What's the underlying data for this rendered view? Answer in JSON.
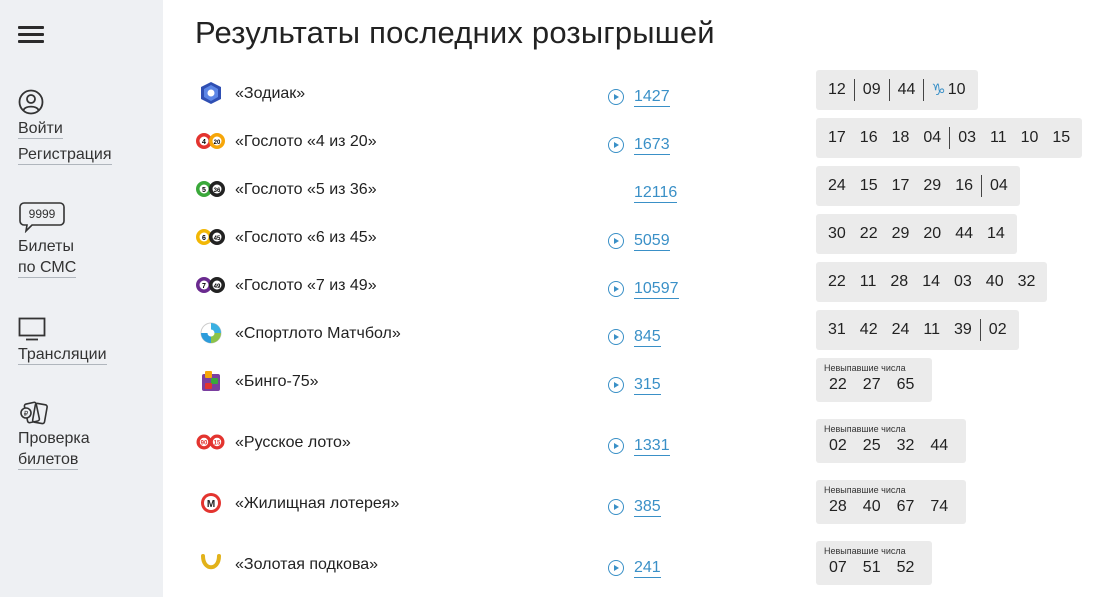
{
  "sidebar": {
    "login": "Войти",
    "register": "Регистрация",
    "sms_badge": "9999",
    "sms_line1": "Билеты",
    "sms_line2": "по СМС",
    "broadcasts": "Трансляции",
    "check_line1": "Проверка",
    "check_line2": "билетов"
  },
  "page": {
    "title": "Результаты последних розыгрышей"
  },
  "colors": {
    "link": "#3a90c7",
    "sidebar_bg": "#eef0f3",
    "result_bg": "#ebebeb"
  },
  "lotteries": [
    {
      "name": "«Зодиак»",
      "draw": "1427",
      "icon": "zodiac-icon",
      "numbers": [
        "12",
        "09",
        "44"
      ],
      "sign": "♑",
      "sign_num": "10"
    },
    {
      "name": "«Гослото «4 из 20»",
      "draw": "1673",
      "icon": "gosloto-4-20-icon",
      "numbers": [
        "17",
        "16",
        "18",
        "04"
      ],
      "numbers2": [
        "03",
        "11",
        "10",
        "15"
      ]
    },
    {
      "name": "«Гослото «5 из 36»",
      "draw": "12116",
      "icon": "gosloto-5-36-icon",
      "numbers": [
        "24",
        "15",
        "17",
        "29",
        "16"
      ],
      "numbers2": [
        "04"
      ]
    },
    {
      "name": "«Гослото «6 из 45»",
      "draw": "5059",
      "icon": "gosloto-6-45-icon",
      "numbers": [
        "30",
        "22",
        "29",
        "20",
        "44",
        "14"
      ]
    },
    {
      "name": "«Гослото «7 из 49»",
      "draw": "10597",
      "icon": "gosloto-7-49-icon",
      "numbers": [
        "22",
        "11",
        "28",
        "14",
        "03",
        "40",
        "32"
      ]
    },
    {
      "name": "«Спортлото Матчбол»",
      "draw": "845",
      "icon": "matchball-icon",
      "numbers": [
        "31",
        "42",
        "24",
        "11",
        "39"
      ],
      "numbers2": [
        "02"
      ]
    },
    {
      "name": "«Бинго-75»",
      "draw": "315",
      "icon": "bingo-75-icon",
      "caption": "Невыпавшие числа",
      "numbers": [
        "22",
        "27",
        "65"
      ]
    },
    {
      "name": "«Русское лото»",
      "draw": "1331",
      "icon": "russian-loto-icon",
      "caption": "Невыпавшие числа",
      "numbers": [
        "02",
        "25",
        "32",
        "44"
      ]
    },
    {
      "name": "«Жилищная лотерея»",
      "draw": "385",
      "icon": "housing-lottery-icon",
      "caption": "Невыпавшие числа",
      "numbers": [
        "28",
        "40",
        "67",
        "74"
      ]
    },
    {
      "name": "«Золотая подкова»",
      "draw": "241",
      "icon": "golden-horseshoe-icon",
      "caption": "Невыпавшие числа",
      "numbers": [
        "07",
        "51",
        "52"
      ]
    }
  ]
}
